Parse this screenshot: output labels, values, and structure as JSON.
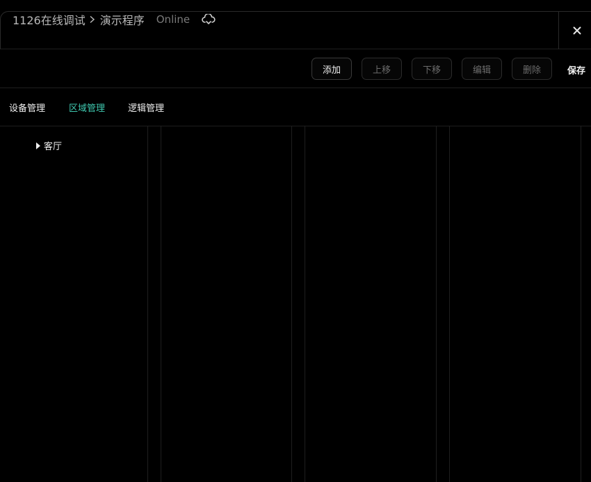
{
  "header": {
    "breadcrumb_root": "1126在线调试",
    "breadcrumb_current": "演示程序",
    "status": "Online",
    "cloud_icon": "cloud-sync-icon",
    "close_icon": "close-icon"
  },
  "toolbar": {
    "buttons": [
      {
        "label": "添加",
        "state": "enabled"
      },
      {
        "label": "上移",
        "state": "disabled"
      },
      {
        "label": "下移",
        "state": "disabled"
      },
      {
        "label": "编辑",
        "state": "disabled"
      },
      {
        "label": "删除",
        "state": "disabled"
      }
    ],
    "save_label": "保存"
  },
  "tabs": [
    {
      "label": "设备管理",
      "selected": false
    },
    {
      "label": "区域管理",
      "selected": true
    },
    {
      "label": "逻辑管理",
      "selected": false
    }
  ],
  "tree": {
    "items": [
      {
        "label": "客厅",
        "expanded": false
      }
    ]
  },
  "colors": {
    "background": "#000000",
    "accent": "#3fc9b0",
    "text": "#f0f0f0",
    "muted": "#6c6c6c",
    "border": "#2a2a2a"
  }
}
